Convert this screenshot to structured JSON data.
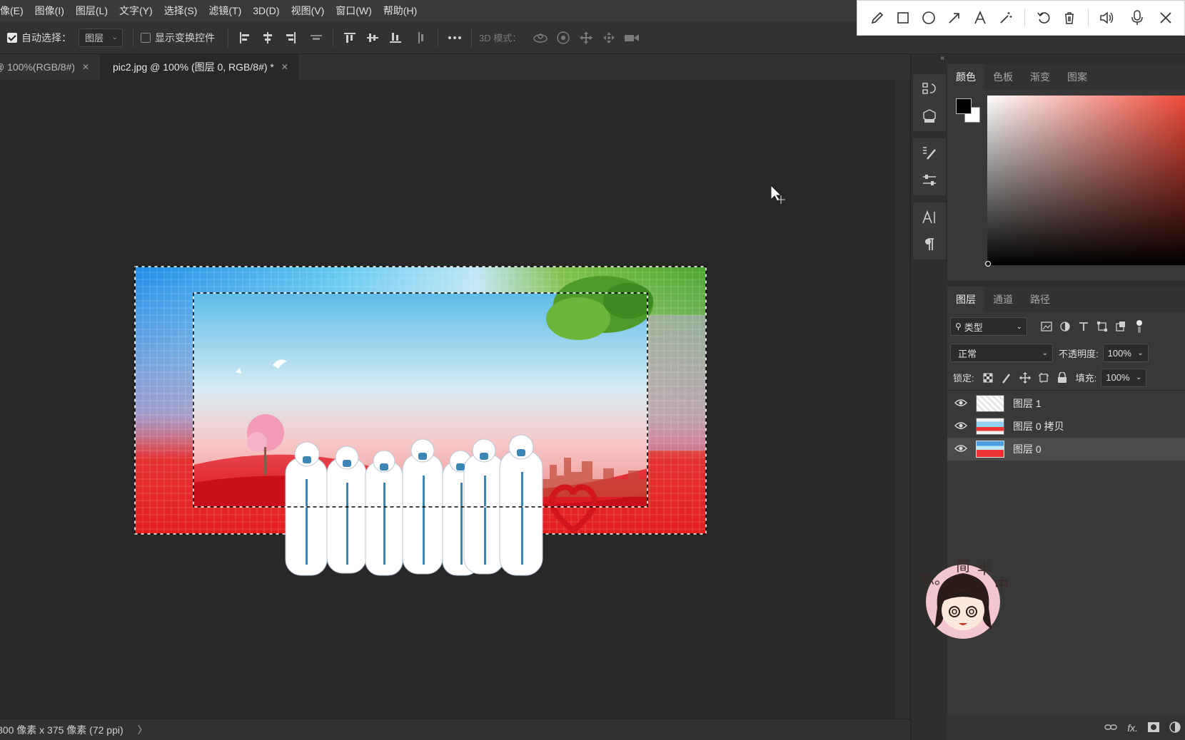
{
  "menu": [
    "像(E)",
    "图像(I)",
    "图层(L)",
    "文字(Y)",
    "选择(S)",
    "滤镜(T)",
    "3D(D)",
    "视图(V)",
    "窗口(W)",
    "帮助(H)"
  ],
  "options": {
    "auto_select_label": "自动选择：",
    "auto_select_value": "图层",
    "show_transform_label": "显示变换控件",
    "three_d_mode_label": "3D 模式："
  },
  "tabs": [
    {
      "label": "@ 100%(RGB/8#)",
      "active": false
    },
    {
      "label": "pic2.jpg @ 100% (图层 0, RGB/8#) *",
      "active": true
    }
  ],
  "status": {
    "doc_info": "800 像素 x 375 像素 (72 ppi)",
    "arrow": "〉"
  },
  "color_panel": {
    "tabs": [
      "颜色",
      "色板",
      "渐变",
      "图案"
    ],
    "foreground": "#000000",
    "background": "#ffffff",
    "hue_color": "#f04a3a"
  },
  "layers_panel": {
    "tabs": [
      "图层",
      "通道",
      "路径"
    ],
    "filter_kind": "类型",
    "blend_mode": "正常",
    "opacity_label": "不透明度:",
    "opacity_value": "100%",
    "lock_label": "锁定:",
    "fill_label": "填充:",
    "fill_value": "100%",
    "layers": [
      {
        "name": "图层 1",
        "selected": false
      },
      {
        "name": "图层 0 拷贝",
        "selected": false
      },
      {
        "name": "图层 0",
        "selected": true
      }
    ],
    "footer_fx": "fx."
  },
  "avatar_text": [
    "栋",
    "。",
    "简",
    "半",
    "中"
  ]
}
